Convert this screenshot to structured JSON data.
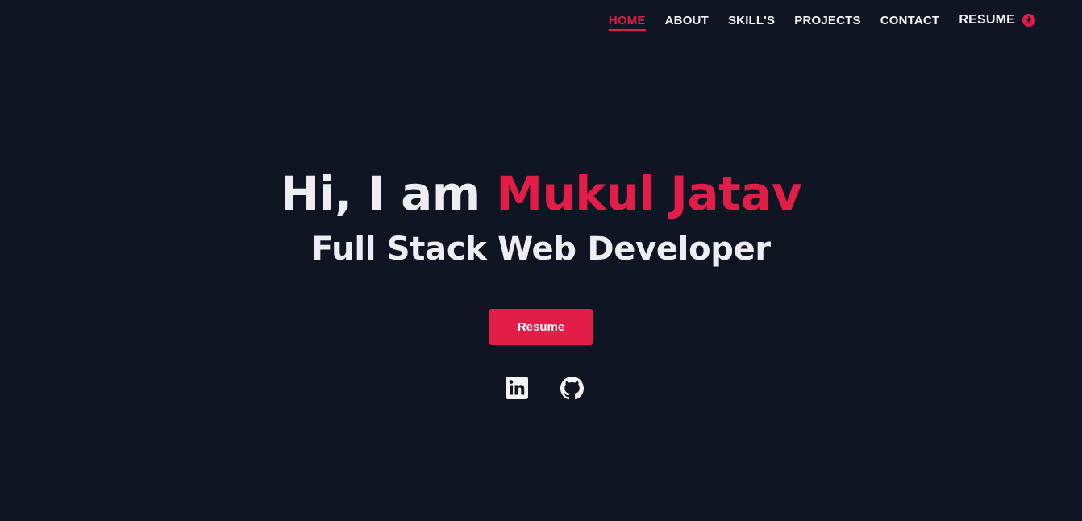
{
  "nav": {
    "items": [
      {
        "label": "HOME",
        "active": true
      },
      {
        "label": "ABOUT",
        "active": false
      },
      {
        "label": "SKILL'S",
        "active": false
      },
      {
        "label": "PROJECTS",
        "active": false
      },
      {
        "label": "CONTACT",
        "active": false
      }
    ],
    "resume_label": "RESUME",
    "resume_icon": "download-circle-icon"
  },
  "hero": {
    "greeting": "Hi, I am",
    "name": "Mukul Jatav",
    "subtitle": "Full Stack Web Developer",
    "button_label": "Resume"
  },
  "socials": [
    {
      "icon": "linkedin-icon"
    },
    {
      "icon": "github-icon"
    }
  ],
  "colors": {
    "background": "#0f1522",
    "accent": "#e11d48",
    "text": "#eceef2"
  }
}
